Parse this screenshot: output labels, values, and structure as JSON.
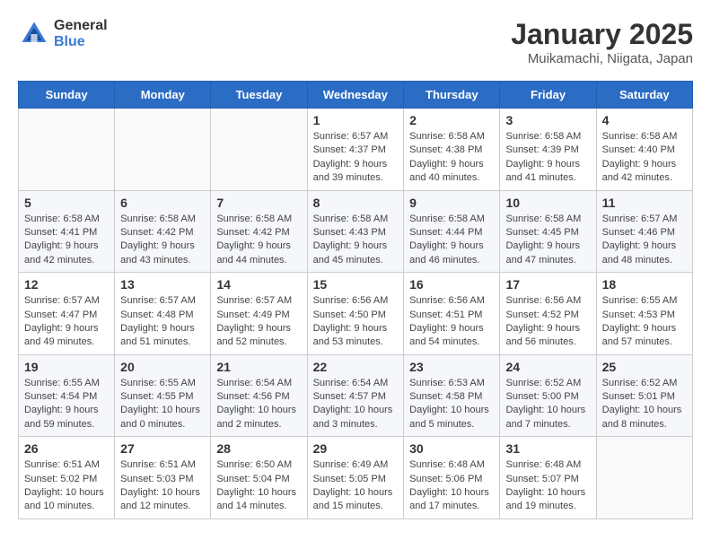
{
  "header": {
    "logo_general": "General",
    "logo_blue": "Blue",
    "title": "January 2025",
    "subtitle": "Muikamachi, Niigata, Japan"
  },
  "weekdays": [
    "Sunday",
    "Monday",
    "Tuesday",
    "Wednesday",
    "Thursday",
    "Friday",
    "Saturday"
  ],
  "weeks": [
    [
      {
        "day": "",
        "sunrise": "",
        "sunset": "",
        "daylight": ""
      },
      {
        "day": "",
        "sunrise": "",
        "sunset": "",
        "daylight": ""
      },
      {
        "day": "",
        "sunrise": "",
        "sunset": "",
        "daylight": ""
      },
      {
        "day": "1",
        "sunrise": "Sunrise: 6:57 AM",
        "sunset": "Sunset: 4:37 PM",
        "daylight": "Daylight: 9 hours and 39 minutes."
      },
      {
        "day": "2",
        "sunrise": "Sunrise: 6:58 AM",
        "sunset": "Sunset: 4:38 PM",
        "daylight": "Daylight: 9 hours and 40 minutes."
      },
      {
        "day": "3",
        "sunrise": "Sunrise: 6:58 AM",
        "sunset": "Sunset: 4:39 PM",
        "daylight": "Daylight: 9 hours and 41 minutes."
      },
      {
        "day": "4",
        "sunrise": "Sunrise: 6:58 AM",
        "sunset": "Sunset: 4:40 PM",
        "daylight": "Daylight: 9 hours and 42 minutes."
      }
    ],
    [
      {
        "day": "5",
        "sunrise": "Sunrise: 6:58 AM",
        "sunset": "Sunset: 4:41 PM",
        "daylight": "Daylight: 9 hours and 42 minutes."
      },
      {
        "day": "6",
        "sunrise": "Sunrise: 6:58 AM",
        "sunset": "Sunset: 4:42 PM",
        "daylight": "Daylight: 9 hours and 43 minutes."
      },
      {
        "day": "7",
        "sunrise": "Sunrise: 6:58 AM",
        "sunset": "Sunset: 4:42 PM",
        "daylight": "Daylight: 9 hours and 44 minutes."
      },
      {
        "day": "8",
        "sunrise": "Sunrise: 6:58 AM",
        "sunset": "Sunset: 4:43 PM",
        "daylight": "Daylight: 9 hours and 45 minutes."
      },
      {
        "day": "9",
        "sunrise": "Sunrise: 6:58 AM",
        "sunset": "Sunset: 4:44 PM",
        "daylight": "Daylight: 9 hours and 46 minutes."
      },
      {
        "day": "10",
        "sunrise": "Sunrise: 6:58 AM",
        "sunset": "Sunset: 4:45 PM",
        "daylight": "Daylight: 9 hours and 47 minutes."
      },
      {
        "day": "11",
        "sunrise": "Sunrise: 6:57 AM",
        "sunset": "Sunset: 4:46 PM",
        "daylight": "Daylight: 9 hours and 48 minutes."
      }
    ],
    [
      {
        "day": "12",
        "sunrise": "Sunrise: 6:57 AM",
        "sunset": "Sunset: 4:47 PM",
        "daylight": "Daylight: 9 hours and 49 minutes."
      },
      {
        "day": "13",
        "sunrise": "Sunrise: 6:57 AM",
        "sunset": "Sunset: 4:48 PM",
        "daylight": "Daylight: 9 hours and 51 minutes."
      },
      {
        "day": "14",
        "sunrise": "Sunrise: 6:57 AM",
        "sunset": "Sunset: 4:49 PM",
        "daylight": "Daylight: 9 hours and 52 minutes."
      },
      {
        "day": "15",
        "sunrise": "Sunrise: 6:56 AM",
        "sunset": "Sunset: 4:50 PM",
        "daylight": "Daylight: 9 hours and 53 minutes."
      },
      {
        "day": "16",
        "sunrise": "Sunrise: 6:56 AM",
        "sunset": "Sunset: 4:51 PM",
        "daylight": "Daylight: 9 hours and 54 minutes."
      },
      {
        "day": "17",
        "sunrise": "Sunrise: 6:56 AM",
        "sunset": "Sunset: 4:52 PM",
        "daylight": "Daylight: 9 hours and 56 minutes."
      },
      {
        "day": "18",
        "sunrise": "Sunrise: 6:55 AM",
        "sunset": "Sunset: 4:53 PM",
        "daylight": "Daylight: 9 hours and 57 minutes."
      }
    ],
    [
      {
        "day": "19",
        "sunrise": "Sunrise: 6:55 AM",
        "sunset": "Sunset: 4:54 PM",
        "daylight": "Daylight: 9 hours and 59 minutes."
      },
      {
        "day": "20",
        "sunrise": "Sunrise: 6:55 AM",
        "sunset": "Sunset: 4:55 PM",
        "daylight": "Daylight: 10 hours and 0 minutes."
      },
      {
        "day": "21",
        "sunrise": "Sunrise: 6:54 AM",
        "sunset": "Sunset: 4:56 PM",
        "daylight": "Daylight: 10 hours and 2 minutes."
      },
      {
        "day": "22",
        "sunrise": "Sunrise: 6:54 AM",
        "sunset": "Sunset: 4:57 PM",
        "daylight": "Daylight: 10 hours and 3 minutes."
      },
      {
        "day": "23",
        "sunrise": "Sunrise: 6:53 AM",
        "sunset": "Sunset: 4:58 PM",
        "daylight": "Daylight: 10 hours and 5 minutes."
      },
      {
        "day": "24",
        "sunrise": "Sunrise: 6:52 AM",
        "sunset": "Sunset: 5:00 PM",
        "daylight": "Daylight: 10 hours and 7 minutes."
      },
      {
        "day": "25",
        "sunrise": "Sunrise: 6:52 AM",
        "sunset": "Sunset: 5:01 PM",
        "daylight": "Daylight: 10 hours and 8 minutes."
      }
    ],
    [
      {
        "day": "26",
        "sunrise": "Sunrise: 6:51 AM",
        "sunset": "Sunset: 5:02 PM",
        "daylight": "Daylight: 10 hours and 10 minutes."
      },
      {
        "day": "27",
        "sunrise": "Sunrise: 6:51 AM",
        "sunset": "Sunset: 5:03 PM",
        "daylight": "Daylight: 10 hours and 12 minutes."
      },
      {
        "day": "28",
        "sunrise": "Sunrise: 6:50 AM",
        "sunset": "Sunset: 5:04 PM",
        "daylight": "Daylight: 10 hours and 14 minutes."
      },
      {
        "day": "29",
        "sunrise": "Sunrise: 6:49 AM",
        "sunset": "Sunset: 5:05 PM",
        "daylight": "Daylight: 10 hours and 15 minutes."
      },
      {
        "day": "30",
        "sunrise": "Sunrise: 6:48 AM",
        "sunset": "Sunset: 5:06 PM",
        "daylight": "Daylight: 10 hours and 17 minutes."
      },
      {
        "day": "31",
        "sunrise": "Sunrise: 6:48 AM",
        "sunset": "Sunset: 5:07 PM",
        "daylight": "Daylight: 10 hours and 19 minutes."
      },
      {
        "day": "",
        "sunrise": "",
        "sunset": "",
        "daylight": ""
      }
    ]
  ]
}
